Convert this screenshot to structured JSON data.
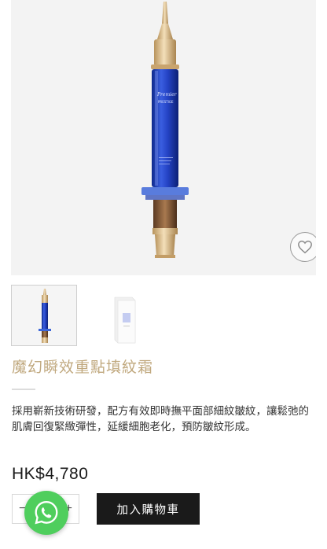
{
  "product": {
    "title": "魔幻瞬效重點填紋霜",
    "description": "採用嶄新技術研發，配方有效即時撫平面部細紋皺紋，讓鬆弛的肌膚回復緊緻彈性，延緩細胞老化，預防皺紋形成。",
    "price": "HK$4,780",
    "bottle_brand": "Premier",
    "bottle_line": "PRESTIGE"
  },
  "cart": {
    "add_label": "加入購物車",
    "qty_minus": "−",
    "qty_plus": "+"
  },
  "icons": {
    "wishlist": "heart-icon",
    "chat": "whatsapp-icon"
  },
  "colors": {
    "title": "#c0a87e",
    "button": "#1a1a1a",
    "whatsapp": "#4fce5d",
    "bottle_blue": "#1f3fb0",
    "gold": "#d8b98a"
  }
}
